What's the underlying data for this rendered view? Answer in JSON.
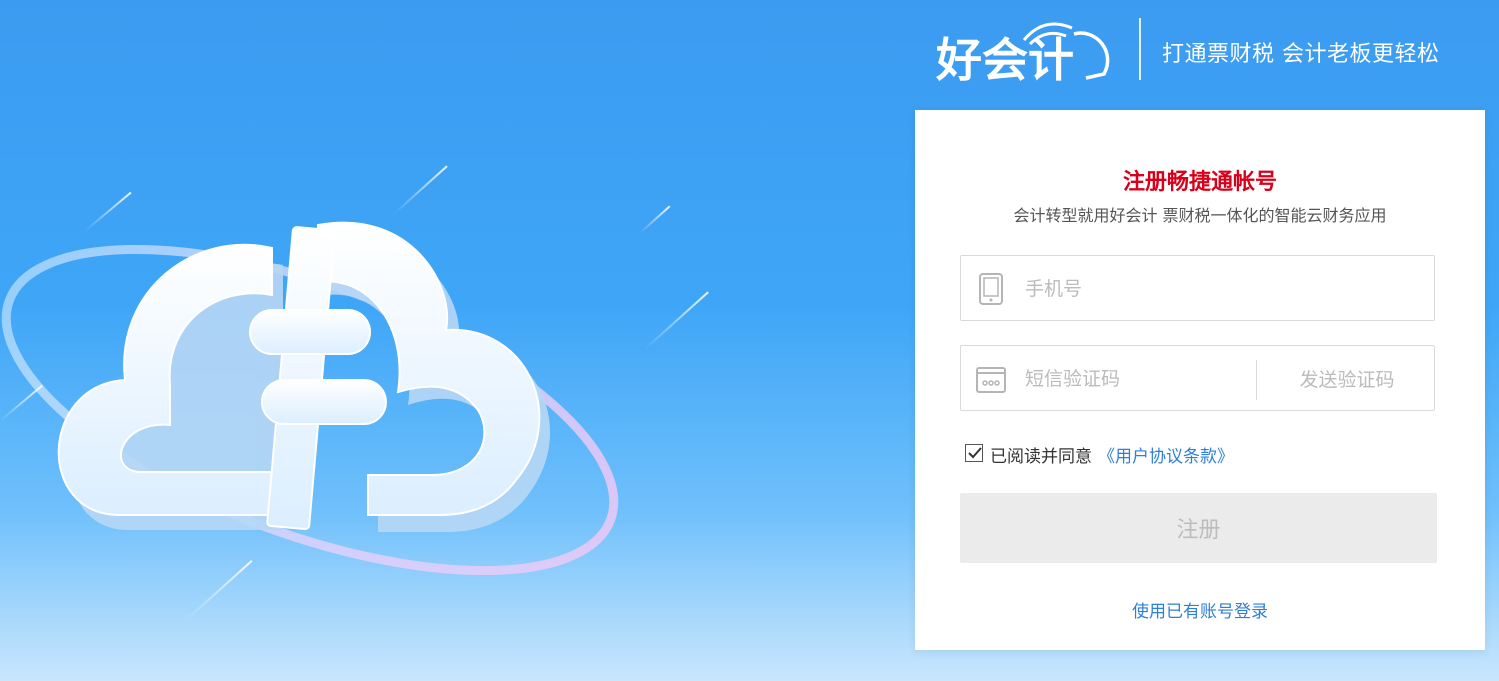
{
  "brand": {
    "logo_text": "好会计",
    "slogan": "打通票财税 会计老板更轻松"
  },
  "form": {
    "title": "注册畅捷通帐号",
    "subtitle": "会计转型就用好会计 票财税一体化的智能云财务应用",
    "phone_placeholder": "手机号",
    "phone_value": "",
    "sms_placeholder": "短信验证码",
    "sms_value": "",
    "send_code_label": "发送验证码",
    "agree_checked": true,
    "agree_text": "已阅读并同意",
    "agree_link": "《用户协议条款》",
    "submit_label": "注册",
    "login_link": "使用已有账号登录"
  },
  "icons": {
    "hero": "cloud-logo-illustration-icon",
    "phone": "mobile-phone-icon",
    "sms": "sms-code-icon",
    "check": "checkmark-icon"
  },
  "colors": {
    "background_top": "#3b9bf0",
    "background_bottom": "#c9e6fd",
    "title_red": "#d9001b",
    "link_blue": "#2e7fd8",
    "button_disabled": "#ebebeb"
  }
}
